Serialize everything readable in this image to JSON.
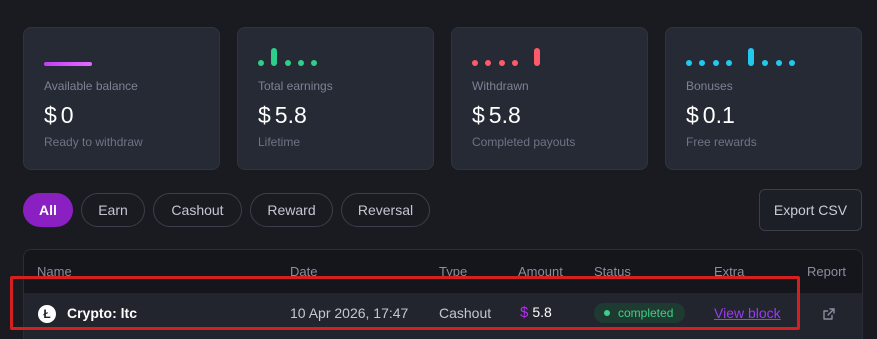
{
  "cards": [
    {
      "label": "Available balance",
      "currency": "$",
      "value": "0",
      "sub": "Ready to withdraw",
      "accent": "#c23ff5",
      "icon": "balance-line-icon"
    },
    {
      "label": "Total earnings",
      "currency": "$",
      "value": "5.8",
      "sub": "Lifetime",
      "accent": "#2ecf8a",
      "icon": "earnings-dots-icon"
    },
    {
      "label": "Withdrawn",
      "currency": "$",
      "value": "5.8",
      "sub": "Completed payouts",
      "accent": "#ff5a6a",
      "icon": "withdrawn-dots-icon"
    },
    {
      "label": "Bonuses",
      "currency": "$",
      "value": "0.1",
      "sub": "Free rewards",
      "accent": "#22c9ef",
      "icon": "bonuses-dots-icon"
    }
  ],
  "filters": {
    "all": "All",
    "earn": "Earn",
    "cashout": "Cashout",
    "reward": "Reward",
    "reversal": "Reversal",
    "active": "All"
  },
  "export_label": "Export CSV",
  "table": {
    "headers": {
      "name": "Name",
      "date": "Date",
      "type": "Type",
      "amount": "Amount",
      "status": "Status",
      "extra": "Extra",
      "report": "Report"
    },
    "rows": [
      {
        "icon": "litecoin-icon",
        "icon_glyph": "Ł",
        "name": "Crypto: ltc",
        "date": "10 Apr 2026, 17:47",
        "type": "Cashout",
        "currency": "$",
        "amount": "5.8",
        "status": "completed",
        "extra": "View block",
        "report_icon": "external-link-icon"
      }
    ]
  },
  "colors": {
    "accent_purple": "#8a1fc2",
    "status_green": "#3fcf89",
    "highlight_red": "#d62020"
  }
}
